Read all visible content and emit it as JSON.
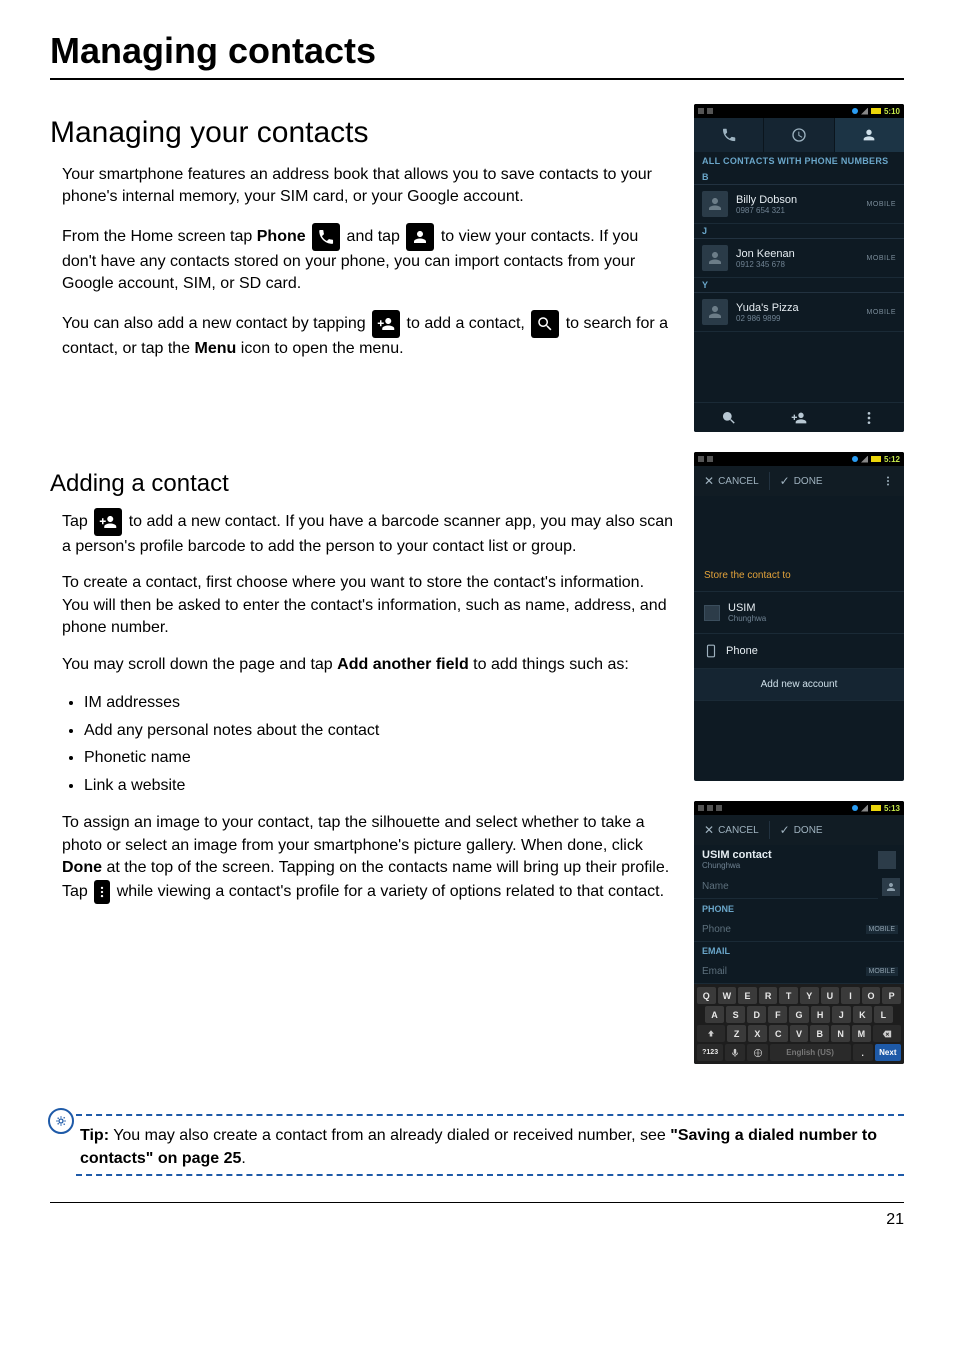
{
  "chapter_title": "Managing contacts",
  "section_title": "Managing your contacts",
  "intro_para": "Your smartphone features an address book that allows you to save contacts to your phone's internal memory, your SIM card, or your Google account.",
  "p2": {
    "a": "From the Home screen tap ",
    "phone_bold": "Phone",
    "b": " and tap ",
    "c": " to view your contacts. If you don't have any contacts stored on your phone, you can import contacts from your Google account, SIM, or SD card."
  },
  "p3": {
    "a": "You can also add a new contact by tapping ",
    "b": " to add a contact, ",
    "c": " to search for a contact, or tap the ",
    "menu_bold": "Menu",
    "d": " icon to open the menu."
  },
  "sub_heading": "Adding a contact",
  "p4": {
    "a": "Tap ",
    "b": " to add a new contact. If you have a barcode scanner app, you may also scan a person's profile barcode to add the person to your contact list or group."
  },
  "p5": "To create a contact, first choose where you want to store the contact's information. You will then be asked to enter the contact's information, such as name, address, and phone number.",
  "p6": {
    "a": "You may scroll down the page and tap ",
    "bold": "Add another field",
    "b": " to add things such as:"
  },
  "bullets": [
    "IM addresses",
    "Add any personal notes about the contact",
    "Phonetic name",
    "Link a website"
  ],
  "p7": {
    "a": "To assign an image to your contact, tap the silhouette and select whether to take a photo or select an image from your smartphone's picture gallery. When done, click ",
    "done_bold": "Done",
    "b": " at the top of the screen. Tapping on the contacts name will bring up their profile. Tap ",
    "c": " while viewing a contact's profile for a variety of options related to that contact."
  },
  "tip": {
    "label": "Tip:",
    "text_a": " You may also create a contact from an already dialed or received number, see ",
    "link_bold": "\"Saving a dialed number to contacts\" on page 25",
    "text_b": "."
  },
  "page_number": "21",
  "shot1": {
    "time": "5:10",
    "section_header": "ALL CONTACTS WITH PHONE NUMBERS",
    "groups": [
      {
        "letter": "B",
        "items": [
          {
            "name": "Billy Dobson",
            "num": "0987 654 321",
            "type": "MOBILE"
          }
        ]
      },
      {
        "letter": "J",
        "items": [
          {
            "name": "Jon Keenan",
            "num": "0912 345 678",
            "type": "MOBILE"
          }
        ]
      },
      {
        "letter": "Y",
        "items": [
          {
            "name": "Yuda's Pizza",
            "num": "02 986 9899",
            "type": "MOBILE"
          }
        ]
      }
    ]
  },
  "shot2": {
    "time": "5:12",
    "cancel": "CANCEL",
    "done": "DONE",
    "store_label": "Store the contact to",
    "usim": {
      "title": "USIM",
      "sub": "Chunghwa"
    },
    "phone": "Phone",
    "add_account": "Add new account"
  },
  "shot3": {
    "time": "5:13",
    "cancel": "CANCEL",
    "done": "DONE",
    "account": {
      "title": "USIM contact",
      "sub": "Chunghwa"
    },
    "name_ph": "Name",
    "phone_section": "PHONE",
    "phone_ph": "Phone",
    "phone_type": "MOBILE",
    "email_section": "EMAIL",
    "email_ph": "Email",
    "email_type": "MOBILE",
    "keyboard": {
      "r1": [
        "Q",
        "W",
        "E",
        "R",
        "T",
        "Y",
        "U",
        "I",
        "O",
        "P"
      ],
      "r2": [
        "A",
        "S",
        "D",
        "F",
        "G",
        "H",
        "J",
        "K",
        "L"
      ],
      "r3_keys": [
        "Z",
        "X",
        "C",
        "V",
        "B",
        "N",
        "M"
      ],
      "sym": "?123",
      "space": "English (US)",
      "next": "Next"
    }
  }
}
